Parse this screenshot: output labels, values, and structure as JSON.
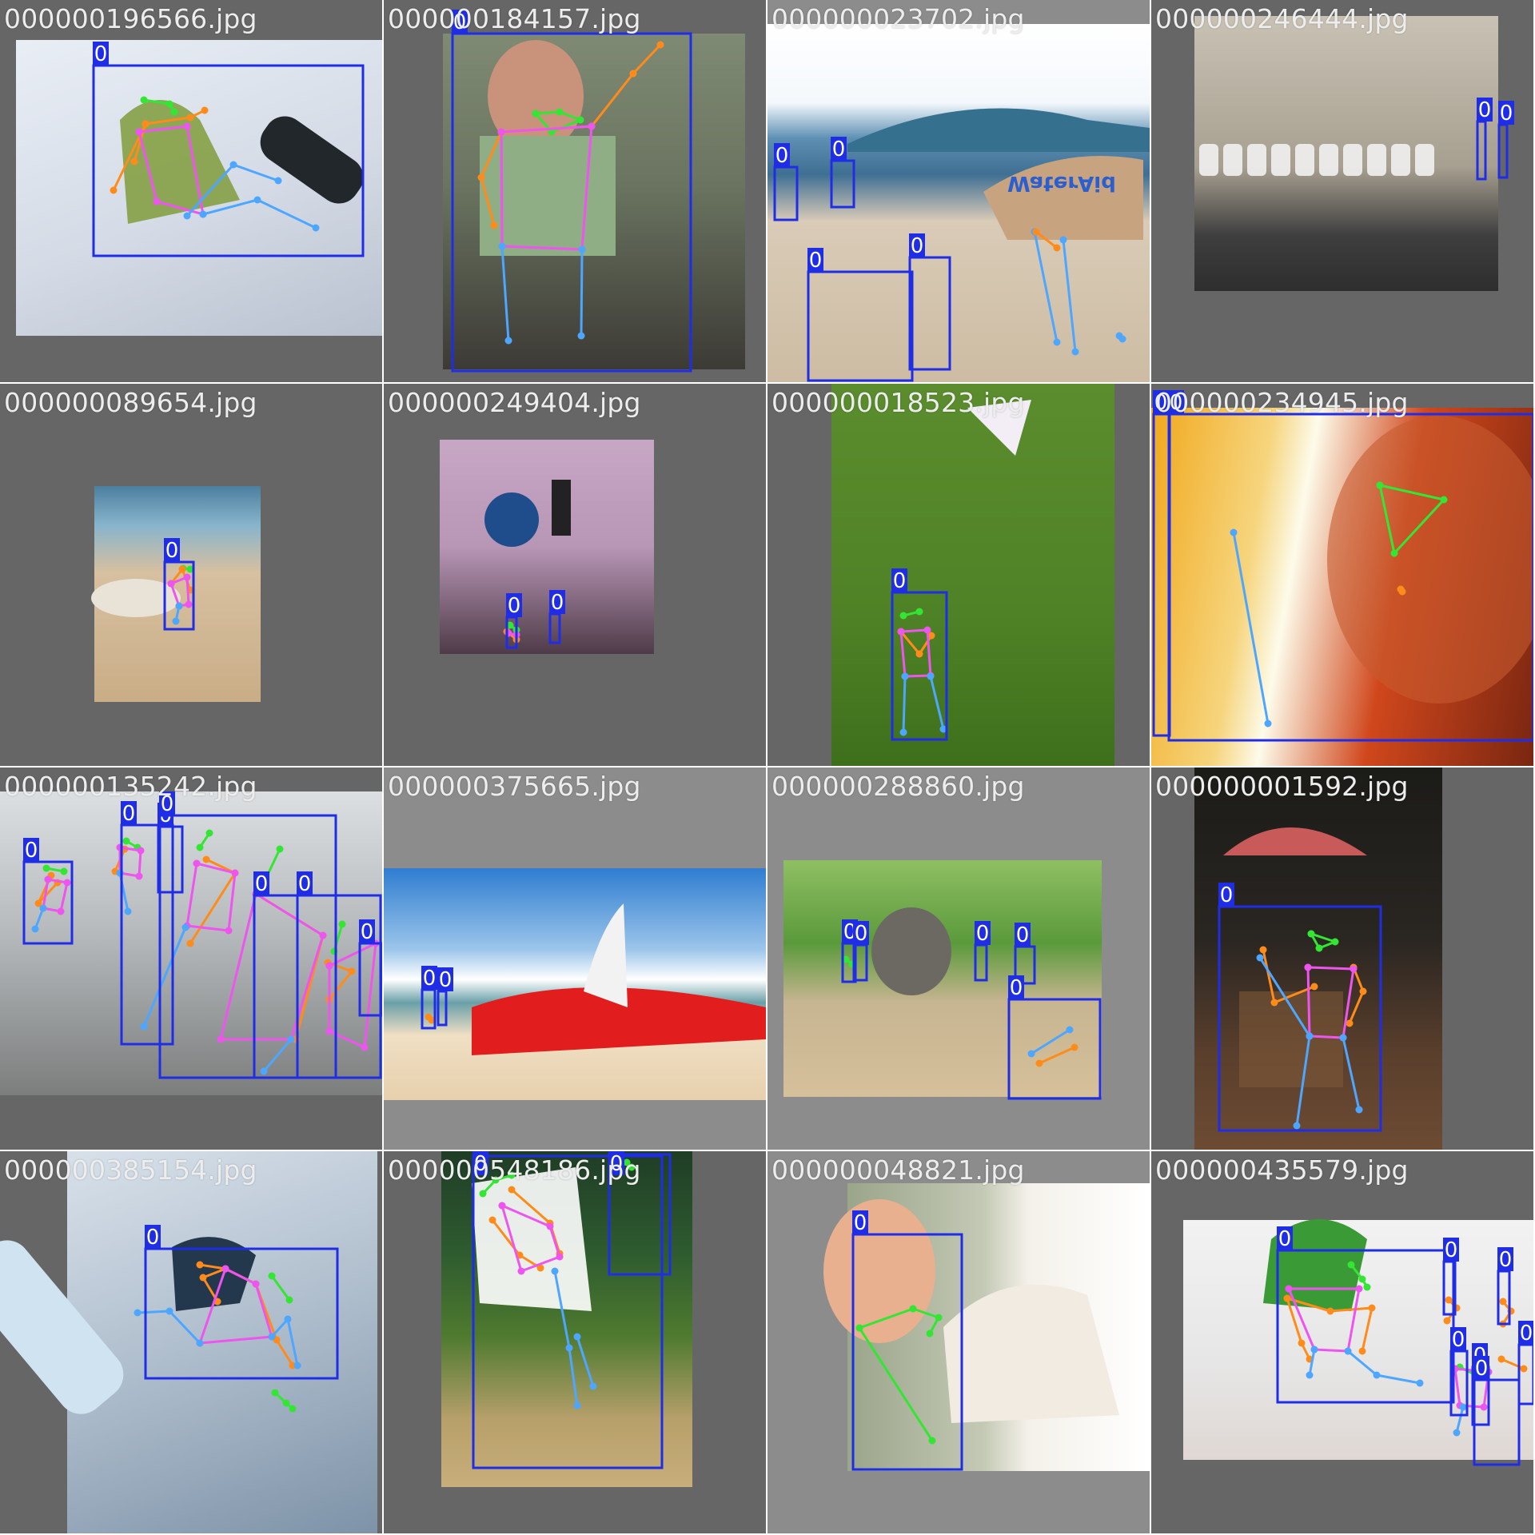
{
  "tiles": [
    {
      "filename": "000000196566.jpg",
      "scene": "snowboarder-sitting",
      "labels": [
        "0"
      ]
    },
    {
      "filename": "000000184157.jpg",
      "scene": "boy-with-game-controller",
      "labels": [
        "0"
      ]
    },
    {
      "filename": "000000023702.jpg",
      "scene": "beach-horse-riders",
      "labels": [
        "0",
        "0",
        "0",
        "0"
      ],
      "sign_text": "WaterAid"
    },
    {
      "filename": "000000246444.jpg",
      "scene": "street-motorcycles",
      "labels": [
        "0",
        "0"
      ]
    },
    {
      "filename": "000000089654.jpg",
      "scene": "horse-rider-beach",
      "labels": [
        "0"
      ]
    },
    {
      "filename": "000000249404.jpg",
      "scene": "traffic-light-sign",
      "labels": [
        "0",
        "0"
      ]
    },
    {
      "filename": "000000018523.jpg",
      "scene": "girl-flying-kite",
      "labels": [
        "0"
      ]
    },
    {
      "filename": "000000234945.jpg",
      "scene": "woman-on-phone",
      "labels": [
        "0",
        "0"
      ]
    },
    {
      "filename": "000000135242.jpg",
      "scene": "crowd-at-exhibition",
      "labels": [
        "0",
        "0",
        "0",
        "0",
        "0",
        "0",
        "0"
      ]
    },
    {
      "filename": "000000375665.jpg",
      "scene": "surfboard-on-beach",
      "labels": [
        "0",
        "0"
      ]
    },
    {
      "filename": "000000288860.jpg",
      "scene": "elephant-in-zoo",
      "labels": [
        "0",
        "0",
        "0",
        "0",
        "0"
      ]
    },
    {
      "filename": "000000001592.jpg",
      "scene": "girl-in-rocking-chair",
      "labels": [
        "0"
      ]
    },
    {
      "filename": "000000385154.jpg",
      "scene": "snowboarder-falling",
      "labels": [
        "0"
      ]
    },
    {
      "filename": "000000548186.jpg",
      "scene": "tennis-player-serving",
      "labels": [
        "0",
        "0"
      ]
    },
    {
      "filename": "000000048821.jpg",
      "scene": "boy-and-goat",
      "labels": [
        "0"
      ]
    },
    {
      "filename": "000000435579.jpg",
      "scene": "kids-snowboarding",
      "labels": [
        "0",
        "0",
        "0",
        "0",
        "0",
        "0",
        "0"
      ]
    }
  ],
  "colors": {
    "box": "#1f2ee6",
    "label_bg": "#1f2ee6",
    "label_text": "#ffffff",
    "face": "#33e633",
    "arm": "#ff8c1a",
    "torso": "#ee55ee",
    "leg": "#4da6ff",
    "tile_bg_dark": "#666666",
    "tile_bg_light": "#8c8c8c"
  }
}
